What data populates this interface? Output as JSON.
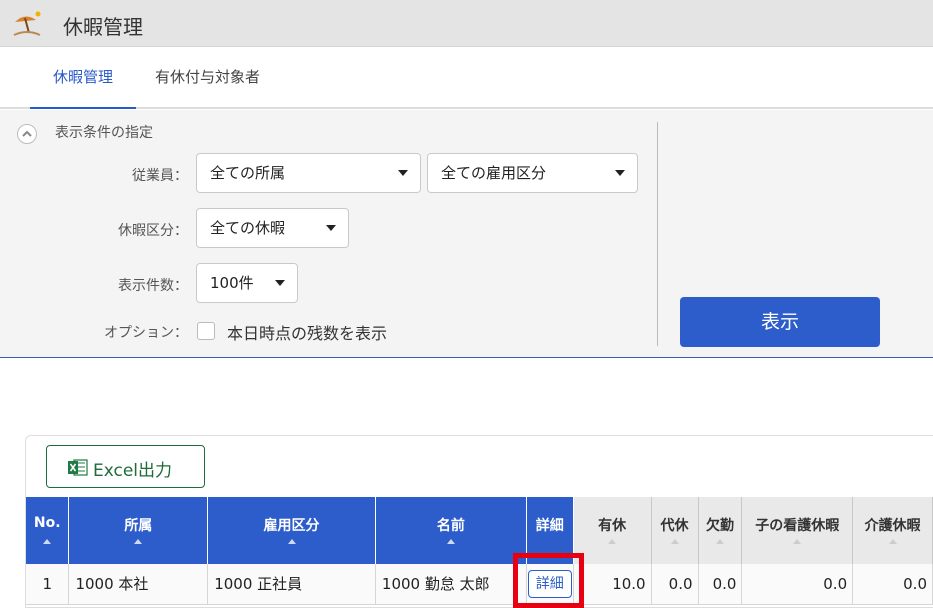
{
  "app": {
    "title": "休暇管理",
    "icon": "beach-parasol-icon"
  },
  "tabs": [
    {
      "label": "休暇管理",
      "active": true
    },
    {
      "label": "有休付与対象者",
      "active": false
    }
  ],
  "filter": {
    "title": "表示条件の指定",
    "employee_label": "従業員：",
    "department_select": "全ての所属",
    "employment_select": "全ての雇用区分",
    "leave_type_label": "休暇区分：",
    "leave_type_select": "全ての休暇",
    "count_label": "表示件数：",
    "count_select": "100件",
    "option_label": "オプション：",
    "option_checkbox_label": "本日時点の残数を表示",
    "option_checked": false,
    "show_button": "表示"
  },
  "results": {
    "excel_button": "Excel出力",
    "columns": [
      "No.",
      "所属",
      "雇用区分",
      "名前",
      "詳細",
      "有休",
      "代休",
      "欠勤",
      "子の看護休暇",
      "介護休暇"
    ],
    "rows": [
      {
        "no": "1",
        "department": "1000 本社",
        "employment": "1000 正社員",
        "name": "1000 勤怠 太郎",
        "detail": "詳細",
        "paid_leave": "10.0",
        "comp_leave": "0.0",
        "absence": "0.0",
        "child_care_leave": "0.0",
        "nursing_leave": "0.0"
      }
    ]
  },
  "colors": {
    "accent": "#2d5dca",
    "highlight": "#e60012",
    "excel_green": "#1f6b3a"
  }
}
